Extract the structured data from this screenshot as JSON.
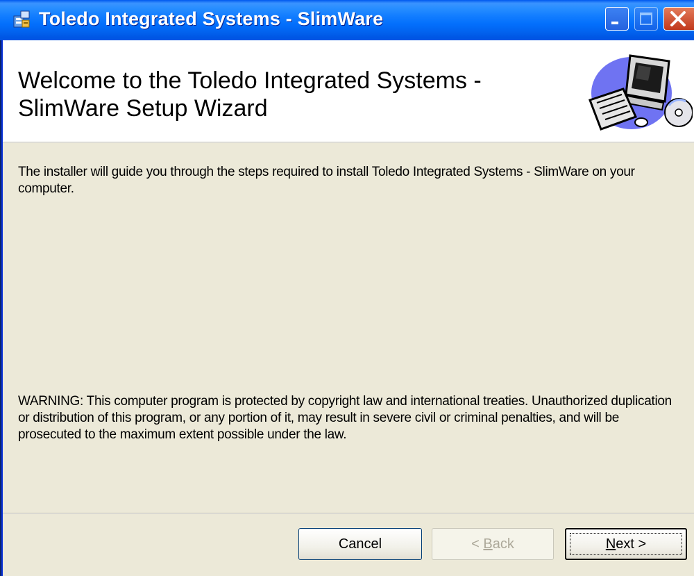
{
  "window": {
    "title": "Toledo Integrated Systems - SlimWare",
    "icon": "installer-icon",
    "controls": {
      "minimize": "minimize-icon",
      "maximize": "maximize-icon",
      "close": "close-icon"
    }
  },
  "banner": {
    "title_line1": "Welcome to the Toledo Integrated Systems -",
    "title_line2": "SlimWare Setup Wizard",
    "image": "computer-setup-icon"
  },
  "body": {
    "intro": "The installer will guide you through the steps required to install Toledo Integrated Systems - SlimWare on your computer.",
    "warning": "WARNING: This computer program is protected by copyright law and international treaties. Unauthorized duplication or distribution of this program, or any portion of it, may result in severe civil or criminal penalties, and will be prosecuted to the maximum extent possible under the law."
  },
  "buttons": {
    "cancel": "Cancel",
    "back_prefix": "< ",
    "back_mnemonic": "B",
    "back_rest": "ack",
    "next_mnemonic": "N",
    "next_rest": "ext >"
  },
  "colors": {
    "titlebar": "#0054e3",
    "dialog_bg": "#ece9d8",
    "banner_bg": "#ffffff",
    "close_button": "#c1381c"
  }
}
